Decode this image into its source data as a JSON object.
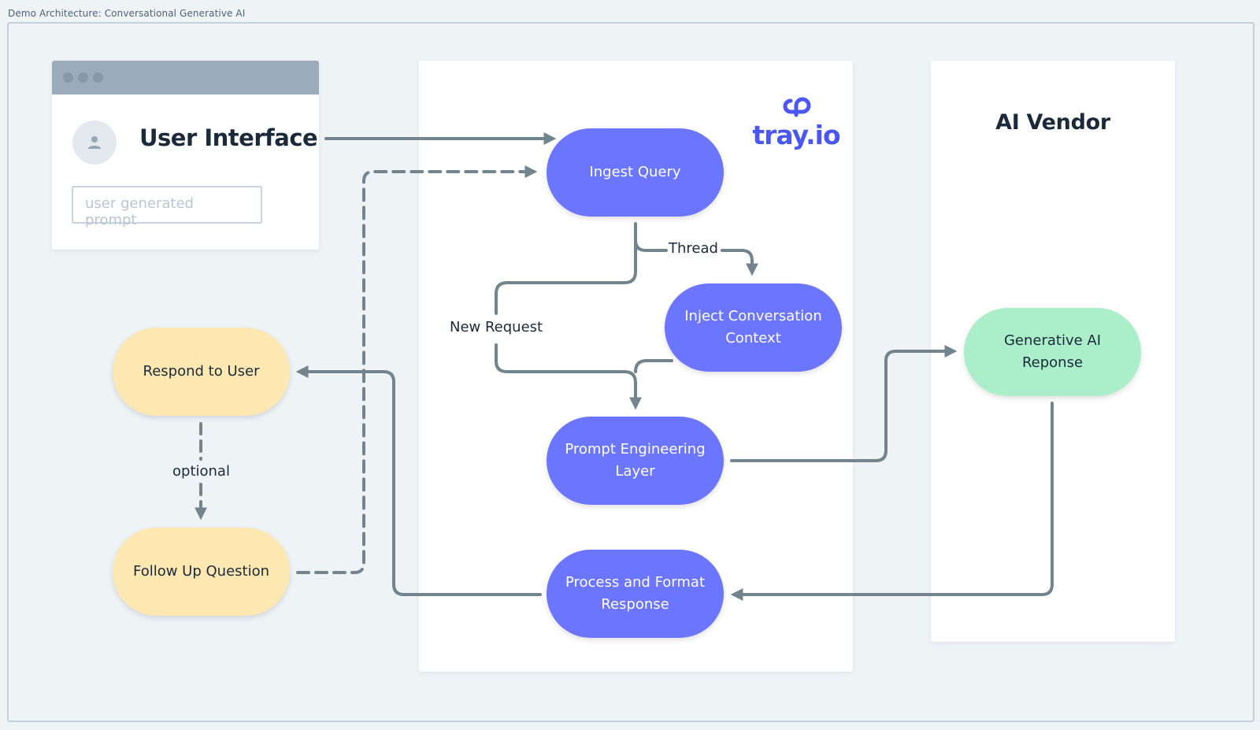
{
  "frame": {
    "title": "Demo Architecture: Conversational Generative AI"
  },
  "user_interface": {
    "heading": "User Interface",
    "avatar_icon": "user-icon",
    "prompt_placeholder": "user generated prompt",
    "window_dots": 3
  },
  "tray_panel": {
    "logo_text": "tray.io",
    "logo_icon": "tray-logo-icon"
  },
  "vendor_panel": {
    "title": "AI Vendor"
  },
  "nodes": {
    "ingest_query": "Ingest Query",
    "inject_context": "Inject Conversation Context",
    "prompt_layer": "Prompt Engineering Layer",
    "process_response": "Process and Format Response",
    "gen_ai_response": "Generative AI Reponse",
    "respond_user": "Respond to User",
    "follow_up": "Follow Up Question"
  },
  "edge_labels": {
    "thread": "Thread",
    "new_request": "New Request",
    "optional": "optional"
  },
  "colors": {
    "tray_node": "#6b75fd",
    "user_node": "#fde8b2",
    "vendor_node": "#aaefc9",
    "connector": "#72858f",
    "brand": "#4b57f2"
  }
}
